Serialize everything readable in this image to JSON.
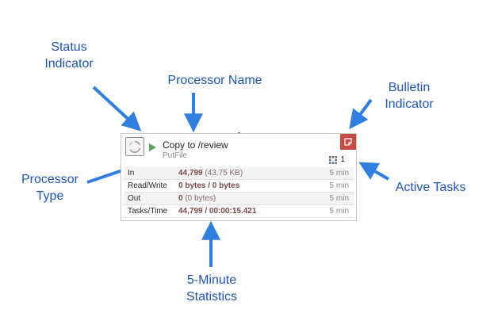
{
  "callouts": {
    "status_indicator": "Status\nIndicator",
    "processor_name": "Processor Name",
    "bulletin_indicator": "Bulletin\nIndicator",
    "processor_type": "Processor\nType",
    "active_tasks": "Active Tasks",
    "five_minute_statistics": "5-Minute\nStatistics"
  },
  "processor": {
    "name": "Copy to /review",
    "type": "PutFile",
    "status": "running",
    "active_tasks": "1",
    "bulletin_color": "#c44c43",
    "stats": [
      {
        "label": "In",
        "value": "44,799",
        "sub": " (43.75 KB)",
        "window": "5 min"
      },
      {
        "label": "Read/Write",
        "value": "0 bytes / 0 bytes",
        "sub": "",
        "window": "5 min"
      },
      {
        "label": "Out",
        "value": "0",
        "sub": " (0 bytes)",
        "window": "5 min"
      },
      {
        "label": "Tasks/Time",
        "value": "44,799 / 00:00:15.421",
        "sub": "",
        "window": "5 min"
      }
    ]
  },
  "colors": {
    "callout_text": "#1f55b5",
    "arrow": "#2f7ee0",
    "run_indicator": "#5aa25a"
  }
}
